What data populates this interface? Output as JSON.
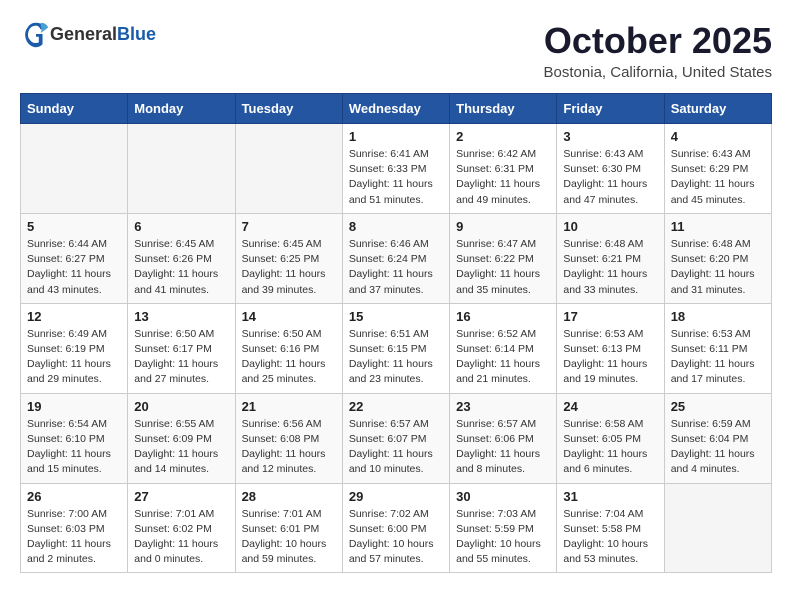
{
  "header": {
    "logo_general": "General",
    "logo_blue": "Blue",
    "title": "October 2025",
    "subtitle": "Bostonia, California, United States"
  },
  "weekdays": [
    "Sunday",
    "Monday",
    "Tuesday",
    "Wednesday",
    "Thursday",
    "Friday",
    "Saturday"
  ],
  "weeks": [
    [
      {
        "day": "",
        "info": ""
      },
      {
        "day": "",
        "info": ""
      },
      {
        "day": "",
        "info": ""
      },
      {
        "day": "1",
        "info": "Sunrise: 6:41 AM\nSunset: 6:33 PM\nDaylight: 11 hours\nand 51 minutes."
      },
      {
        "day": "2",
        "info": "Sunrise: 6:42 AM\nSunset: 6:31 PM\nDaylight: 11 hours\nand 49 minutes."
      },
      {
        "day": "3",
        "info": "Sunrise: 6:43 AM\nSunset: 6:30 PM\nDaylight: 11 hours\nand 47 minutes."
      },
      {
        "day": "4",
        "info": "Sunrise: 6:43 AM\nSunset: 6:29 PM\nDaylight: 11 hours\nand 45 minutes."
      }
    ],
    [
      {
        "day": "5",
        "info": "Sunrise: 6:44 AM\nSunset: 6:27 PM\nDaylight: 11 hours\nand 43 minutes."
      },
      {
        "day": "6",
        "info": "Sunrise: 6:45 AM\nSunset: 6:26 PM\nDaylight: 11 hours\nand 41 minutes."
      },
      {
        "day": "7",
        "info": "Sunrise: 6:45 AM\nSunset: 6:25 PM\nDaylight: 11 hours\nand 39 minutes."
      },
      {
        "day": "8",
        "info": "Sunrise: 6:46 AM\nSunset: 6:24 PM\nDaylight: 11 hours\nand 37 minutes."
      },
      {
        "day": "9",
        "info": "Sunrise: 6:47 AM\nSunset: 6:22 PM\nDaylight: 11 hours\nand 35 minutes."
      },
      {
        "day": "10",
        "info": "Sunrise: 6:48 AM\nSunset: 6:21 PM\nDaylight: 11 hours\nand 33 minutes."
      },
      {
        "day": "11",
        "info": "Sunrise: 6:48 AM\nSunset: 6:20 PM\nDaylight: 11 hours\nand 31 minutes."
      }
    ],
    [
      {
        "day": "12",
        "info": "Sunrise: 6:49 AM\nSunset: 6:19 PM\nDaylight: 11 hours\nand 29 minutes."
      },
      {
        "day": "13",
        "info": "Sunrise: 6:50 AM\nSunset: 6:17 PM\nDaylight: 11 hours\nand 27 minutes."
      },
      {
        "day": "14",
        "info": "Sunrise: 6:50 AM\nSunset: 6:16 PM\nDaylight: 11 hours\nand 25 minutes."
      },
      {
        "day": "15",
        "info": "Sunrise: 6:51 AM\nSunset: 6:15 PM\nDaylight: 11 hours\nand 23 minutes."
      },
      {
        "day": "16",
        "info": "Sunrise: 6:52 AM\nSunset: 6:14 PM\nDaylight: 11 hours\nand 21 minutes."
      },
      {
        "day": "17",
        "info": "Sunrise: 6:53 AM\nSunset: 6:13 PM\nDaylight: 11 hours\nand 19 minutes."
      },
      {
        "day": "18",
        "info": "Sunrise: 6:53 AM\nSunset: 6:11 PM\nDaylight: 11 hours\nand 17 minutes."
      }
    ],
    [
      {
        "day": "19",
        "info": "Sunrise: 6:54 AM\nSunset: 6:10 PM\nDaylight: 11 hours\nand 15 minutes."
      },
      {
        "day": "20",
        "info": "Sunrise: 6:55 AM\nSunset: 6:09 PM\nDaylight: 11 hours\nand 14 minutes."
      },
      {
        "day": "21",
        "info": "Sunrise: 6:56 AM\nSunset: 6:08 PM\nDaylight: 11 hours\nand 12 minutes."
      },
      {
        "day": "22",
        "info": "Sunrise: 6:57 AM\nSunset: 6:07 PM\nDaylight: 11 hours\nand 10 minutes."
      },
      {
        "day": "23",
        "info": "Sunrise: 6:57 AM\nSunset: 6:06 PM\nDaylight: 11 hours\nand 8 minutes."
      },
      {
        "day": "24",
        "info": "Sunrise: 6:58 AM\nSunset: 6:05 PM\nDaylight: 11 hours\nand 6 minutes."
      },
      {
        "day": "25",
        "info": "Sunrise: 6:59 AM\nSunset: 6:04 PM\nDaylight: 11 hours\nand 4 minutes."
      }
    ],
    [
      {
        "day": "26",
        "info": "Sunrise: 7:00 AM\nSunset: 6:03 PM\nDaylight: 11 hours\nand 2 minutes."
      },
      {
        "day": "27",
        "info": "Sunrise: 7:01 AM\nSunset: 6:02 PM\nDaylight: 11 hours\nand 0 minutes."
      },
      {
        "day": "28",
        "info": "Sunrise: 7:01 AM\nSunset: 6:01 PM\nDaylight: 10 hours\nand 59 minutes."
      },
      {
        "day": "29",
        "info": "Sunrise: 7:02 AM\nSunset: 6:00 PM\nDaylight: 10 hours\nand 57 minutes."
      },
      {
        "day": "30",
        "info": "Sunrise: 7:03 AM\nSunset: 5:59 PM\nDaylight: 10 hours\nand 55 minutes."
      },
      {
        "day": "31",
        "info": "Sunrise: 7:04 AM\nSunset: 5:58 PM\nDaylight: 10 hours\nand 53 minutes."
      },
      {
        "day": "",
        "info": ""
      }
    ]
  ]
}
